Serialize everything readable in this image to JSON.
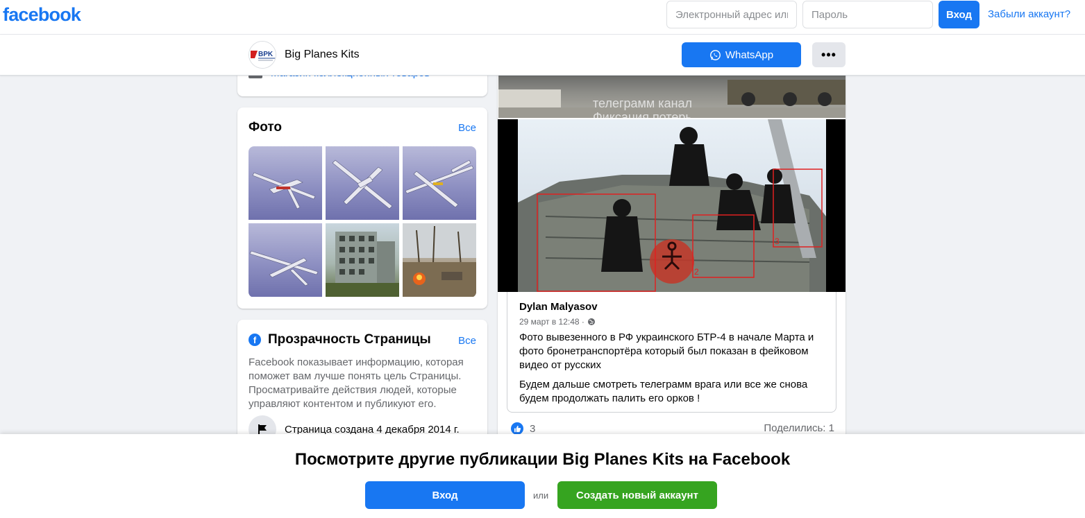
{
  "topbar": {
    "logo": "facebook",
    "email_placeholder": "Электронный адрес или номер телефона",
    "password_placeholder": "Пароль",
    "login_label": "Вход",
    "forgot_label": "Забыли аккаунт?"
  },
  "page_header": {
    "name": "Big Planes Kits",
    "avatar_text": "BPK",
    "whatsapp_label": "WhatsApp",
    "more_label": "•••"
  },
  "about": {
    "snippet": "Магазин коллекционных товаров"
  },
  "photos": {
    "title": "Фото",
    "see_all": "Все"
  },
  "transparency": {
    "title": "Прозрачность Страницы",
    "see_all": "Все",
    "description": "Facebook показывает информацию, которая поможет вам лучше понять цель Страницы. Просматривайте действия людей, которые управляют контентом и публикуют его.",
    "created": "Страница создана 4 декабря 2014 г."
  },
  "post": {
    "top_image_caption_line1": "телеграмм канал",
    "top_image_caption_line2": "Фиксация потерь",
    "markers": [
      "2",
      "3"
    ],
    "author": "Dylan Malyasov",
    "date": "29 март в 12:48 ·",
    "text1": "Фото вывезенного в РФ украинского БТР-4 в начале Марта и фото бронетранспортёра который был показан в фейковом видео от русских",
    "text2": "Будем дальше смотреть телеграмм врага или все же снова будем продолжать палить его орков !",
    "likes": "3",
    "shares": "Поделились: 1"
  },
  "banner": {
    "title": "Посмотрите другие публикации Big Planes Kits на Facebook",
    "login_label": "Вход",
    "or_label": "или",
    "create_label": "Создать новый аккаунт"
  },
  "colors": {
    "brand": "#1877f2",
    "create_green": "#36a420",
    "background": "#f0f2f5"
  }
}
